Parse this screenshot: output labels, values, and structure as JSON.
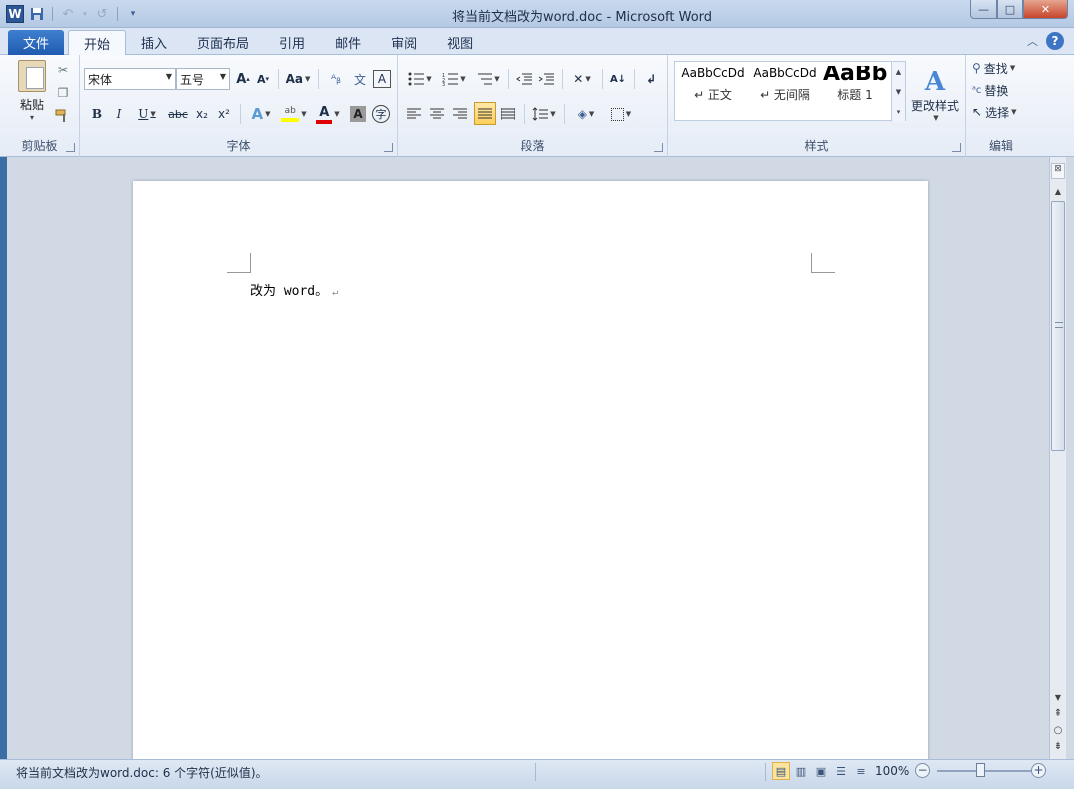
{
  "window": {
    "title": "将当前文档改为word.doc - Microsoft Word",
    "app_icon": "W",
    "minimize": "—",
    "maximize": "□",
    "close": "✕"
  },
  "qat": {
    "save": "save-icon",
    "undo": "undo-icon",
    "redo": "redo-icon",
    "customize": "customize-icon"
  },
  "tabs": {
    "file": "文件",
    "items": [
      "开始",
      "插入",
      "页面布局",
      "引用",
      "邮件",
      "审阅",
      "视图"
    ],
    "active": "开始"
  },
  "clipboard": {
    "paste": "粘贴",
    "label": "剪贴板"
  },
  "font": {
    "name": "宋体",
    "size": "五号",
    "grow": "A",
    "shrink": "A",
    "change_case": "Aa",
    "bold": "B",
    "italic": "I",
    "underline": "U",
    "strike": "abc",
    "subscript": "x₂",
    "superscript": "x²",
    "label": "字体"
  },
  "paragraph": {
    "label": "段落"
  },
  "styles": {
    "items": [
      {
        "sample": "AaBbCcDd",
        "name": "↵ 正文"
      },
      {
        "sample": "AaBbCcDd",
        "name": "↵ 无间隔"
      },
      {
        "sample": "AaBb",
        "name": "标题 1"
      }
    ],
    "change_styles": "更改样式",
    "label": "样式"
  },
  "editing": {
    "find": "查找",
    "replace": "替换",
    "select": "选择",
    "label": "编辑"
  },
  "document": {
    "text": "改为 word。",
    "pilcrow": "↵"
  },
  "status": {
    "text": "将当前文档改为word.doc: 6 个字符(近似值)。",
    "zoom": "100%"
  }
}
